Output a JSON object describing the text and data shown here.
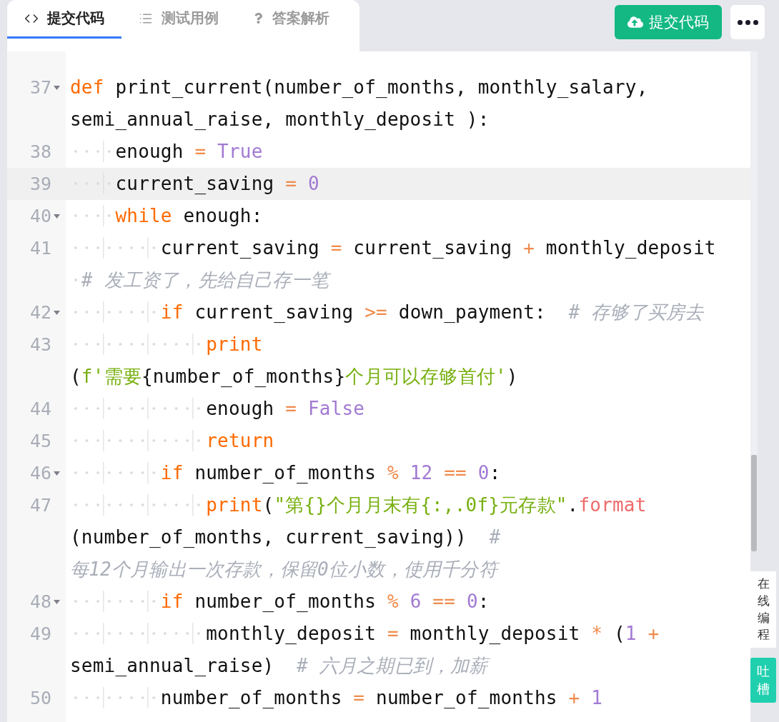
{
  "tabs": [
    {
      "label": "提交代码",
      "selected": true
    },
    {
      "label": "测试用例",
      "selected": false
    },
    {
      "label": "答案解析",
      "selected": false
    }
  ],
  "submit_button": {
    "label": "提交代码"
  },
  "code_lines": [
    {
      "number": "37",
      "foldable": true,
      "active": false,
      "rows": [
        {
          "segments": [
            {
              "kind": "keyword",
              "text": "def"
            },
            {
              "kind": "plain",
              "text": " print_current(number_of_months, monthly_salary,"
            }
          ]
        },
        {
          "segments": [
            {
              "kind": "plain",
              "text": "semi_annual_raise, monthly_deposit ):"
            }
          ]
        }
      ]
    },
    {
      "number": "38",
      "foldable": false,
      "active": false,
      "rows": [
        {
          "segments": [
            {
              "kind": "plain",
              "text": "    enough "
            },
            {
              "kind": "operator",
              "text": "="
            },
            {
              "kind": "number",
              "text": " True"
            }
          ]
        }
      ]
    },
    {
      "number": "39",
      "foldable": false,
      "active": true,
      "rows": [
        {
          "segments": [
            {
              "kind": "plain",
              "text": "    current_saving "
            },
            {
              "kind": "operator",
              "text": "="
            },
            {
              "kind": "number",
              "text": " 0"
            }
          ]
        }
      ]
    },
    {
      "number": "40",
      "foldable": true,
      "active": false,
      "rows": [
        {
          "segments": [
            {
              "kind": "keyword",
              "text": "    while"
            },
            {
              "kind": "plain",
              "text": " enough:"
            }
          ]
        }
      ]
    },
    {
      "number": "41",
      "foldable": false,
      "active": false,
      "rows": [
        {
          "segments": [
            {
              "kind": "plain",
              "text": "        current_saving "
            },
            {
              "kind": "operator",
              "text": "="
            },
            {
              "kind": "plain",
              "text": " current_saving "
            },
            {
              "kind": "operator",
              "text": "+"
            },
            {
              "kind": "plain",
              "text": " monthly_deposit"
            }
          ]
        },
        {
          "segments": [
            {
              "kind": "comment",
              "text": " # 发工资了，先给自己存一笔"
            }
          ]
        }
      ]
    },
    {
      "number": "42",
      "foldable": true,
      "active": false,
      "rows": [
        {
          "segments": [
            {
              "kind": "keyword",
              "text": "        if"
            },
            {
              "kind": "plain",
              "text": " current_saving "
            },
            {
              "kind": "operator",
              "text": ">="
            },
            {
              "kind": "plain",
              "text": " down_payment:  "
            },
            {
              "kind": "comment",
              "text": "# 存够了买房去"
            }
          ]
        }
      ]
    },
    {
      "number": "43",
      "foldable": false,
      "active": false,
      "rows": [
        {
          "segments": [
            {
              "kind": "keyword",
              "text": "            print"
            }
          ]
        },
        {
          "segments": [
            {
              "kind": "plain",
              "text": "("
            },
            {
              "kind": "string",
              "text": "f'需要"
            },
            {
              "kind": "plain",
              "text": "{number_of_months}"
            },
            {
              "kind": "string",
              "text": "个月可以存够首付'"
            },
            {
              "kind": "plain",
              "text": ")"
            }
          ]
        }
      ]
    },
    {
      "number": "44",
      "foldable": false,
      "active": false,
      "rows": [
        {
          "segments": [
            {
              "kind": "plain",
              "text": "            enough "
            },
            {
              "kind": "operator",
              "text": "="
            },
            {
              "kind": "number",
              "text": " False"
            }
          ]
        }
      ]
    },
    {
      "number": "45",
      "foldable": false,
      "active": false,
      "rows": [
        {
          "segments": [
            {
              "kind": "keyword",
              "text": "            return"
            }
          ]
        }
      ]
    },
    {
      "number": "46",
      "foldable": true,
      "active": false,
      "rows": [
        {
          "segments": [
            {
              "kind": "keyword",
              "text": "        if"
            },
            {
              "kind": "plain",
              "text": " number_of_months "
            },
            {
              "kind": "operator",
              "text": "%"
            },
            {
              "kind": "number",
              "text": " 12"
            },
            {
              "kind": "operator",
              "text": " =="
            },
            {
              "kind": "number",
              "text": " 0"
            },
            {
              "kind": "plain",
              "text": ":"
            }
          ]
        }
      ]
    },
    {
      "number": "47",
      "foldable": false,
      "active": false,
      "rows": [
        {
          "segments": [
            {
              "kind": "keyword",
              "text": "            print"
            },
            {
              "kind": "plain",
              "text": "("
            },
            {
              "kind": "string",
              "text": "\"第{}个月月末有{:,.0f}元存款\""
            },
            {
              "kind": "plain",
              "text": "."
            },
            {
              "kind": "method",
              "text": "format"
            }
          ]
        },
        {
          "segments": [
            {
              "kind": "plain",
              "text": "(number_of_months, current_saving))  "
            },
            {
              "kind": "comment",
              "text": "#"
            }
          ]
        },
        {
          "segments": [
            {
              "kind": "comment",
              "text": "每12个月输出一次存款，保留0位小数，使用千分符"
            }
          ]
        }
      ]
    },
    {
      "number": "48",
      "foldable": true,
      "active": false,
      "rows": [
        {
          "segments": [
            {
              "kind": "keyword",
              "text": "        if"
            },
            {
              "kind": "plain",
              "text": " number_of_months "
            },
            {
              "kind": "operator",
              "text": "%"
            },
            {
              "kind": "number",
              "text": " 6"
            },
            {
              "kind": "operator",
              "text": " =="
            },
            {
              "kind": "number",
              "text": " 0"
            },
            {
              "kind": "plain",
              "text": ":"
            }
          ]
        }
      ]
    },
    {
      "number": "49",
      "foldable": false,
      "active": false,
      "rows": [
        {
          "segments": [
            {
              "kind": "plain",
              "text": "            monthly_deposit "
            },
            {
              "kind": "operator",
              "text": "="
            },
            {
              "kind": "plain",
              "text": " monthly_deposit "
            },
            {
              "kind": "operator",
              "text": "*"
            },
            {
              "kind": "plain",
              "text": " ("
            },
            {
              "kind": "number",
              "text": "1"
            },
            {
              "kind": "operator",
              "text": " +"
            }
          ]
        },
        {
          "segments": [
            {
              "kind": "plain",
              "text": "semi_annual_raise)  "
            },
            {
              "kind": "comment",
              "text": "# 六月之期已到，加薪"
            }
          ]
        }
      ]
    },
    {
      "number": "50",
      "foldable": false,
      "active": false,
      "rows": [
        {
          "segments": [
            {
              "kind": "plain",
              "text": "        number_of_months "
            },
            {
              "kind": "operator",
              "text": "="
            },
            {
              "kind": "plain",
              "text": " number_of_months "
            },
            {
              "kind": "operator",
              "text": "+"
            },
            {
              "kind": "number",
              "text": " 1"
            }
          ]
        }
      ]
    }
  ],
  "side_panel": {
    "label": "在线编程"
  },
  "feedback_button": {
    "label": "吐槽"
  }
}
